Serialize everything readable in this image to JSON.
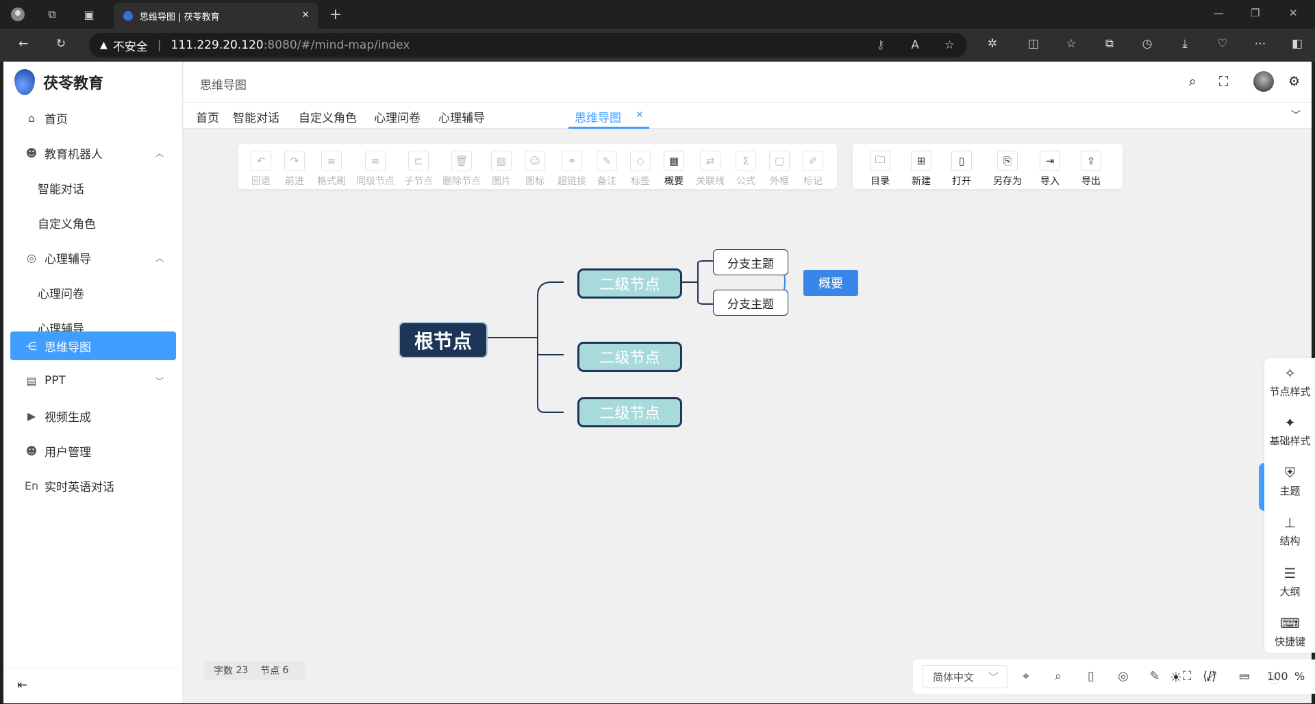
{
  "browser": {
    "tab_title": "思维导图 | 茯苓教育",
    "not_secure": "不安全",
    "url_host": "111.229.20.120",
    "url_rest": ":8080/#/mind-map/index"
  },
  "app": {
    "logo_text": "茯苓教育",
    "breadcrumb": "思维导图",
    "menu": [
      {
        "label": "首页",
        "icon": "home-icon"
      },
      {
        "label": "教育机器人",
        "icon": "robot-icon"
      },
      {
        "label": "智能对话"
      },
      {
        "label": "自定义角色"
      },
      {
        "label": "心理辅导",
        "icon": "heart-icon"
      },
      {
        "label": "心理问卷"
      },
      {
        "label": "心理辅导"
      },
      {
        "label": "思维导图",
        "icon": "share-icon"
      },
      {
        "label": "PPT",
        "icon": "ppt-icon"
      },
      {
        "label": "视频生成",
        "icon": "video-icon"
      },
      {
        "label": "用户管理",
        "icon": "user-icon"
      },
      {
        "label": "实时英语对话",
        "icon": "en-icon"
      }
    ],
    "tags": [
      "首页",
      "智能对话",
      "自定义角色",
      "心理问卷",
      "心理辅导",
      "思维导图"
    ],
    "accent": "#409eff"
  },
  "toolbar": {
    "edit_tools": [
      "回退",
      "前进",
      "格式刷",
      "同级节点",
      "子节点",
      "删除节点",
      "图片",
      "图标",
      "超链接",
      "备注",
      "标签",
      "概要",
      "关联线",
      "公式",
      "外框",
      "标记"
    ],
    "file_tools": [
      "目录",
      "新建",
      "打开",
      "另存为",
      "导入",
      "导出"
    ]
  },
  "mindmap": {
    "root": "根节点",
    "level2": [
      "二级节点",
      "二级节点",
      "二级节点"
    ],
    "branches": [
      "分支主题",
      "分支主题"
    ],
    "summary": "概要"
  },
  "status": {
    "word_label": "字数",
    "word_count": "23",
    "node_label": "节点",
    "node_count": "6"
  },
  "bottom": {
    "language": "简体中文",
    "zoom": "100",
    "percent": "%"
  },
  "right_panel": [
    "节点样式",
    "基础样式",
    "主题",
    "结构",
    "大纲",
    "快捷键"
  ]
}
